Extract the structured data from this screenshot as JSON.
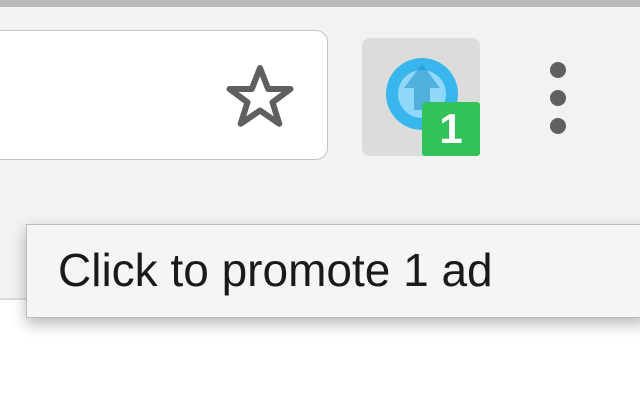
{
  "toolbar": {
    "bookmark_icon": "star-outline-icon",
    "menu_icon": "vertical-dots-menu-icon"
  },
  "extension": {
    "icon": "blue-circle-up-arrow-icon",
    "badge_text": "1",
    "badge_color": "#33c25a",
    "icon_color": "#3ab6ef"
  },
  "tooltip": {
    "text": "Click to promote 1 ad"
  }
}
